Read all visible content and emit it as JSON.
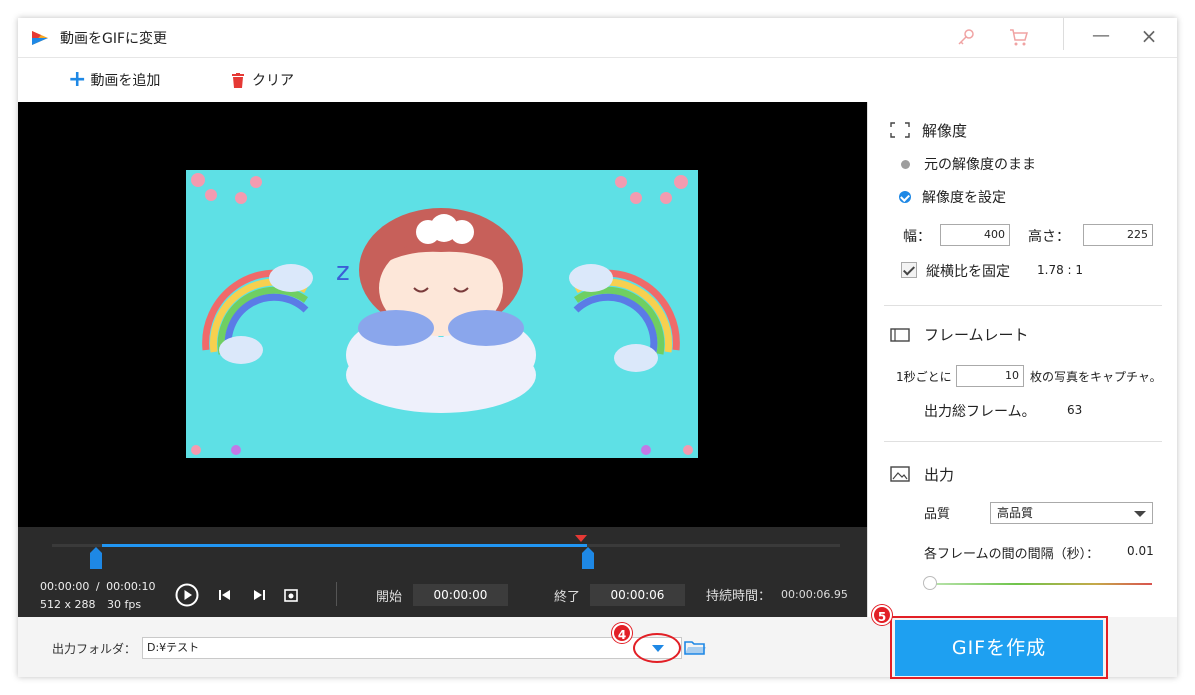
{
  "window": {
    "title": "動画をGIFに変更"
  },
  "toolbar": {
    "add_label": "動画を追加",
    "clear_label": "クリア"
  },
  "controls": {
    "current_time": "00:00:00",
    "separator": "/",
    "total_time": "00:00:10",
    "resolution_info": "512 x 288",
    "fps_info": "30 fps",
    "start_label": "開始",
    "start_value": "00:00:00",
    "end_label": "終了",
    "end_value": "00:00:06",
    "duration_label": "持続時間：",
    "duration_value": "00:00:06.95"
  },
  "output": {
    "folder_label": "出力フォルダ：",
    "folder_value": "D:¥テスト",
    "badge_dropdown": "4",
    "badge_create": "5",
    "create_label": "GIFを作成"
  },
  "settings": {
    "resolution_title": "解像度",
    "keep_original": "元の解像度のまま",
    "set_resolution": "解像度を設定",
    "width_label": "幅：",
    "width_value": "400",
    "height_label": "高さ：",
    "height_value": "225",
    "aspect_label": "縦横比を固定",
    "aspect_value": "1.78 : 1",
    "framerate_title": "フレームレート",
    "per_second_label": "1秒ごとに",
    "per_second_value": "10",
    "capture_suffix": "枚の写真をキャプチャ。",
    "total_frames_label": "出力総フレーム。",
    "total_frames_value": "63",
    "output_title": "出力",
    "quality_label": "品質",
    "quality_value": "高品質",
    "interval_label": "各フレームの間の間隔（秒）：",
    "interval_value": "0.01"
  },
  "colors": {
    "accent": "#1ea0f1",
    "highlight": "#e21f26",
    "player_bg": "#000000",
    "controls_bg": "#2b2b2b"
  }
}
